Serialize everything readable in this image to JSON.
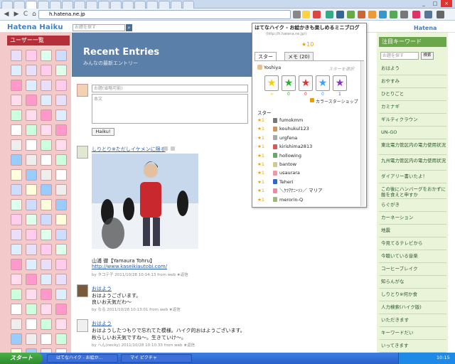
{
  "browser": {
    "url": "h.hatena.ne.jp",
    "tabs": [
      "",
      "",
      "",
      "",
      "",
      "",
      "",
      "",
      "",
      "",
      "",
      "",
      "",
      "",
      "",
      ""
    ],
    "nav": {
      "back": "◀",
      "forward": "▶",
      "reload": "C",
      "home": "⌂"
    }
  },
  "header": {
    "logo": "Hatena Haiku",
    "search_placeholder": "お題を探す",
    "right_logo": "Hatena"
  },
  "left": {
    "title": "ユーザー一覧"
  },
  "banner": {
    "title": "Recent Entries",
    "subtitle": "みんなの最新エントリー"
  },
  "compose": {
    "topic_placeholder": "お題(省略可能)",
    "body_placeholder": "本文",
    "submit": "Haiku!"
  },
  "posts": [
    {
      "title": "しりとり※ただしイケメンに限る",
      "author_line": "山浦 徹【Yamaura Tohru】",
      "link": "http://www.kaseikiautobi.com/",
      "meta": "by タコテ子 2011/10/28 10:14:13 from web ★返信"
    },
    {
      "title": "おはよう",
      "line1": "おはようございます。",
      "line2": "良いお天気だわ〜",
      "meta": "by なる 2011/10/28 10:13:01 from web ★返信"
    },
    {
      "title": "おはよう",
      "line1": "おはようしたつもりで忘れてた模様。ハイク的おはようございます。",
      "line2": "秋らしいお天気ですね〜。生きていけ〜。",
      "meta": "by へん(necky) 2011/10/28 10:10:33 from web ★返信"
    }
  ],
  "popup": {
    "title": "はてなハイク - お絵かきも楽しめるミニブログ",
    "url": "(http://h.hatena.ne.jp/)",
    "star_count": "★10",
    "tabs": [
      "スター",
      "メモ (20)"
    ],
    "user": "Yoshiya",
    "user_hint": "スターを選択",
    "star_colors": [
      "#f5d000",
      "#2db12d",
      "#e03030",
      "#3aa0ff",
      "#8a30c8"
    ],
    "star_counts": [
      "∞",
      "0",
      "0",
      "0",
      "1"
    ],
    "color_shop": "カラースターショップ",
    "list_header": "スター",
    "entries": [
      {
        "count": "★1",
        "name": "fumokmm"
      },
      {
        "count": "★1",
        "name": "kouhukul123"
      },
      {
        "count": "★1",
        "name": "urgfena"
      },
      {
        "count": "★1",
        "name": "kirishima2813"
      },
      {
        "count": "★1",
        "name": "hollowing"
      },
      {
        "count": "★1",
        "name": "bantow"
      },
      {
        "count": "★1",
        "name": "usaurara"
      },
      {
        "count": "★1",
        "name": "Teheri"
      },
      {
        "count": "★1",
        "name": "＼ｹﾂｱﾅﾆｰｿﾝ／ マリア"
      },
      {
        "count": "★1",
        "name": "merorin-Q"
      }
    ]
  },
  "right": {
    "title": "注目キーワード",
    "search_placeholder": "お題を探す",
    "search_btn": "検索",
    "keywords": [
      "おはよう",
      "おやすみ",
      "ひとりごと",
      "カミナギ",
      "ギルティクラウン",
      "UN-GO",
      "東北電力管区内の電力使用状況",
      "九州電力管区内の電力使用状況",
      "ダイアリー書いたよ！",
      "この後にハンバーグをおかずに飯を食えと申すか",
      "らぐがき",
      "カーネーション",
      "地震",
      "今見てるテレビから",
      "今聴いている音楽",
      "コーヒーブレイク",
      "知らんがな",
      "しりとり※何か食",
      "人力検索(ハイク版)",
      "いただきます",
      "キーワードだい",
      "いってきます",
      "何かを受信",
      "おはようございます",
      "花写真",
      "地震情報",
      "懐しい言葉をメモる",
      "ベジータ(グリッチャ..."
    ]
  },
  "taskbar": {
    "start": "スタート",
    "tasks": [
      "はてなハイク - お絵か...",
      "マイ ピクチャ"
    ],
    "clock": "10:15"
  }
}
